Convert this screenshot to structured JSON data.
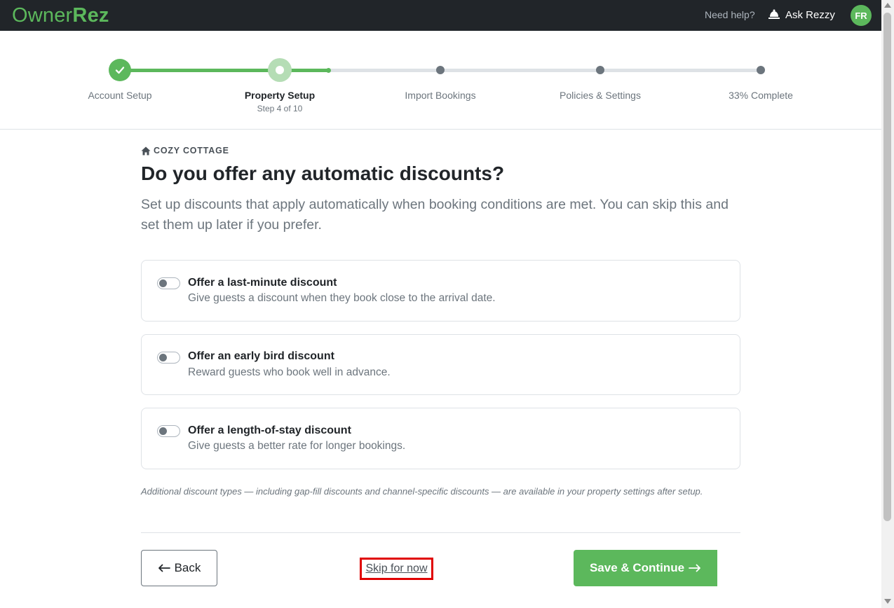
{
  "header": {
    "logo_owner": "Owner",
    "logo_rez": "Rez",
    "help_text": "Need help?",
    "ask_label": "Ask Rezzy",
    "avatar_initials": "FR"
  },
  "stepper": {
    "steps": [
      {
        "label": "Account Setup",
        "state": "done"
      },
      {
        "label": "Property Setup",
        "state": "current",
        "sub": "Step 4 of 10"
      },
      {
        "label": "Import Bookings",
        "state": "upcoming"
      },
      {
        "label": "Policies & Settings",
        "state": "upcoming"
      },
      {
        "label": "33% Complete",
        "state": "upcoming"
      }
    ],
    "progress_fraction": 0.33
  },
  "main": {
    "property_name": "COZY COTTAGE",
    "title": "Do you offer any automatic discounts?",
    "subtitle": "Set up discounts that apply automatically when booking conditions are met. You can skip this and set them up later if you prefer.",
    "options": [
      {
        "title": "Offer a last-minute discount",
        "desc": "Give guests a discount when they book close to the arrival date.",
        "enabled": false
      },
      {
        "title": "Offer an early bird discount",
        "desc": "Reward guests who book well in advance.",
        "enabled": false
      },
      {
        "title": "Offer a length-of-stay discount",
        "desc": "Give guests a better rate for longer bookings.",
        "enabled": false
      }
    ],
    "footnote": "Additional discount types — including gap-fill discounts and channel-specific discounts — are available in your property settings after setup."
  },
  "footer": {
    "back_label": "Back",
    "skip_label": "Skip for now",
    "save_label": "Save & Continue"
  },
  "colors": {
    "brand_green": "#5cb85c",
    "topbar": "#212529",
    "highlight": "#e00000"
  }
}
